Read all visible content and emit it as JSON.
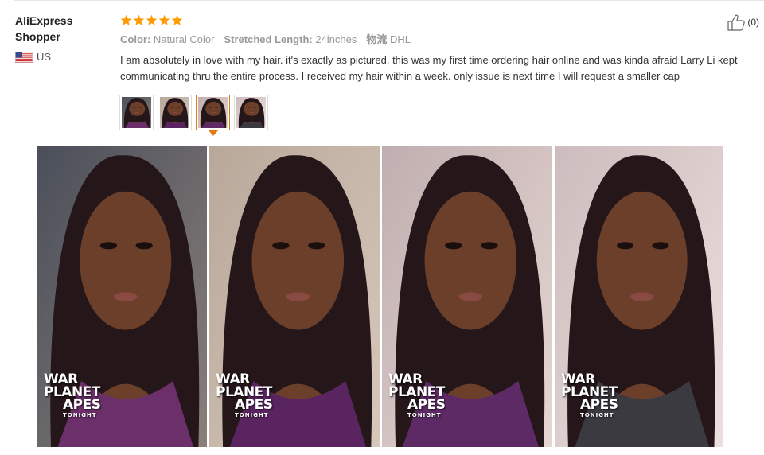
{
  "user": {
    "name": "AliExpress Shopper",
    "country": "US",
    "flag_icon": "us-flag-icon"
  },
  "rating": {
    "stars": 5,
    "max": 5,
    "color": "#ff9a00"
  },
  "attributes": [
    {
      "key": "Color:",
      "value": "Natural Color"
    },
    {
      "key": "Stretched Length:",
      "value": "24inches"
    },
    {
      "key": "物流",
      "value": "DHL"
    }
  ],
  "review": {
    "text": "I am absolutely in love with my hair. it's exactly as pictured. this was my first time ordering hair online and was kinda afraid Larry Li kept communicating thru the entire process. I received my hair within a week. only issue is next time I will request a smaller cap"
  },
  "helpful": {
    "icon": "thumbs-up-icon",
    "count": "(0)"
  },
  "thumbnails": {
    "count": 4,
    "selected_index": 2,
    "accent_color": "#e47911"
  },
  "photos": [
    {
      "name": "review-photo-1",
      "overlay": {
        "l1": "WAR",
        "l2": "PLANET",
        "l3": "APES",
        "l4": "TONIGHT"
      }
    },
    {
      "name": "review-photo-2",
      "overlay": {
        "l1": "WAR",
        "l2": "PLANET",
        "l3": "APES",
        "l4": "TONIGHT"
      }
    },
    {
      "name": "review-photo-3",
      "overlay": {
        "l1": "WAR",
        "l2": "PLANET",
        "l3": "APES",
        "l4": "TONIGHT"
      }
    },
    {
      "name": "review-photo-4",
      "overlay": {
        "l1": "WAR",
        "l2": "PLANET",
        "l3": "APES",
        "l4": "TONIGHT"
      }
    }
  ]
}
